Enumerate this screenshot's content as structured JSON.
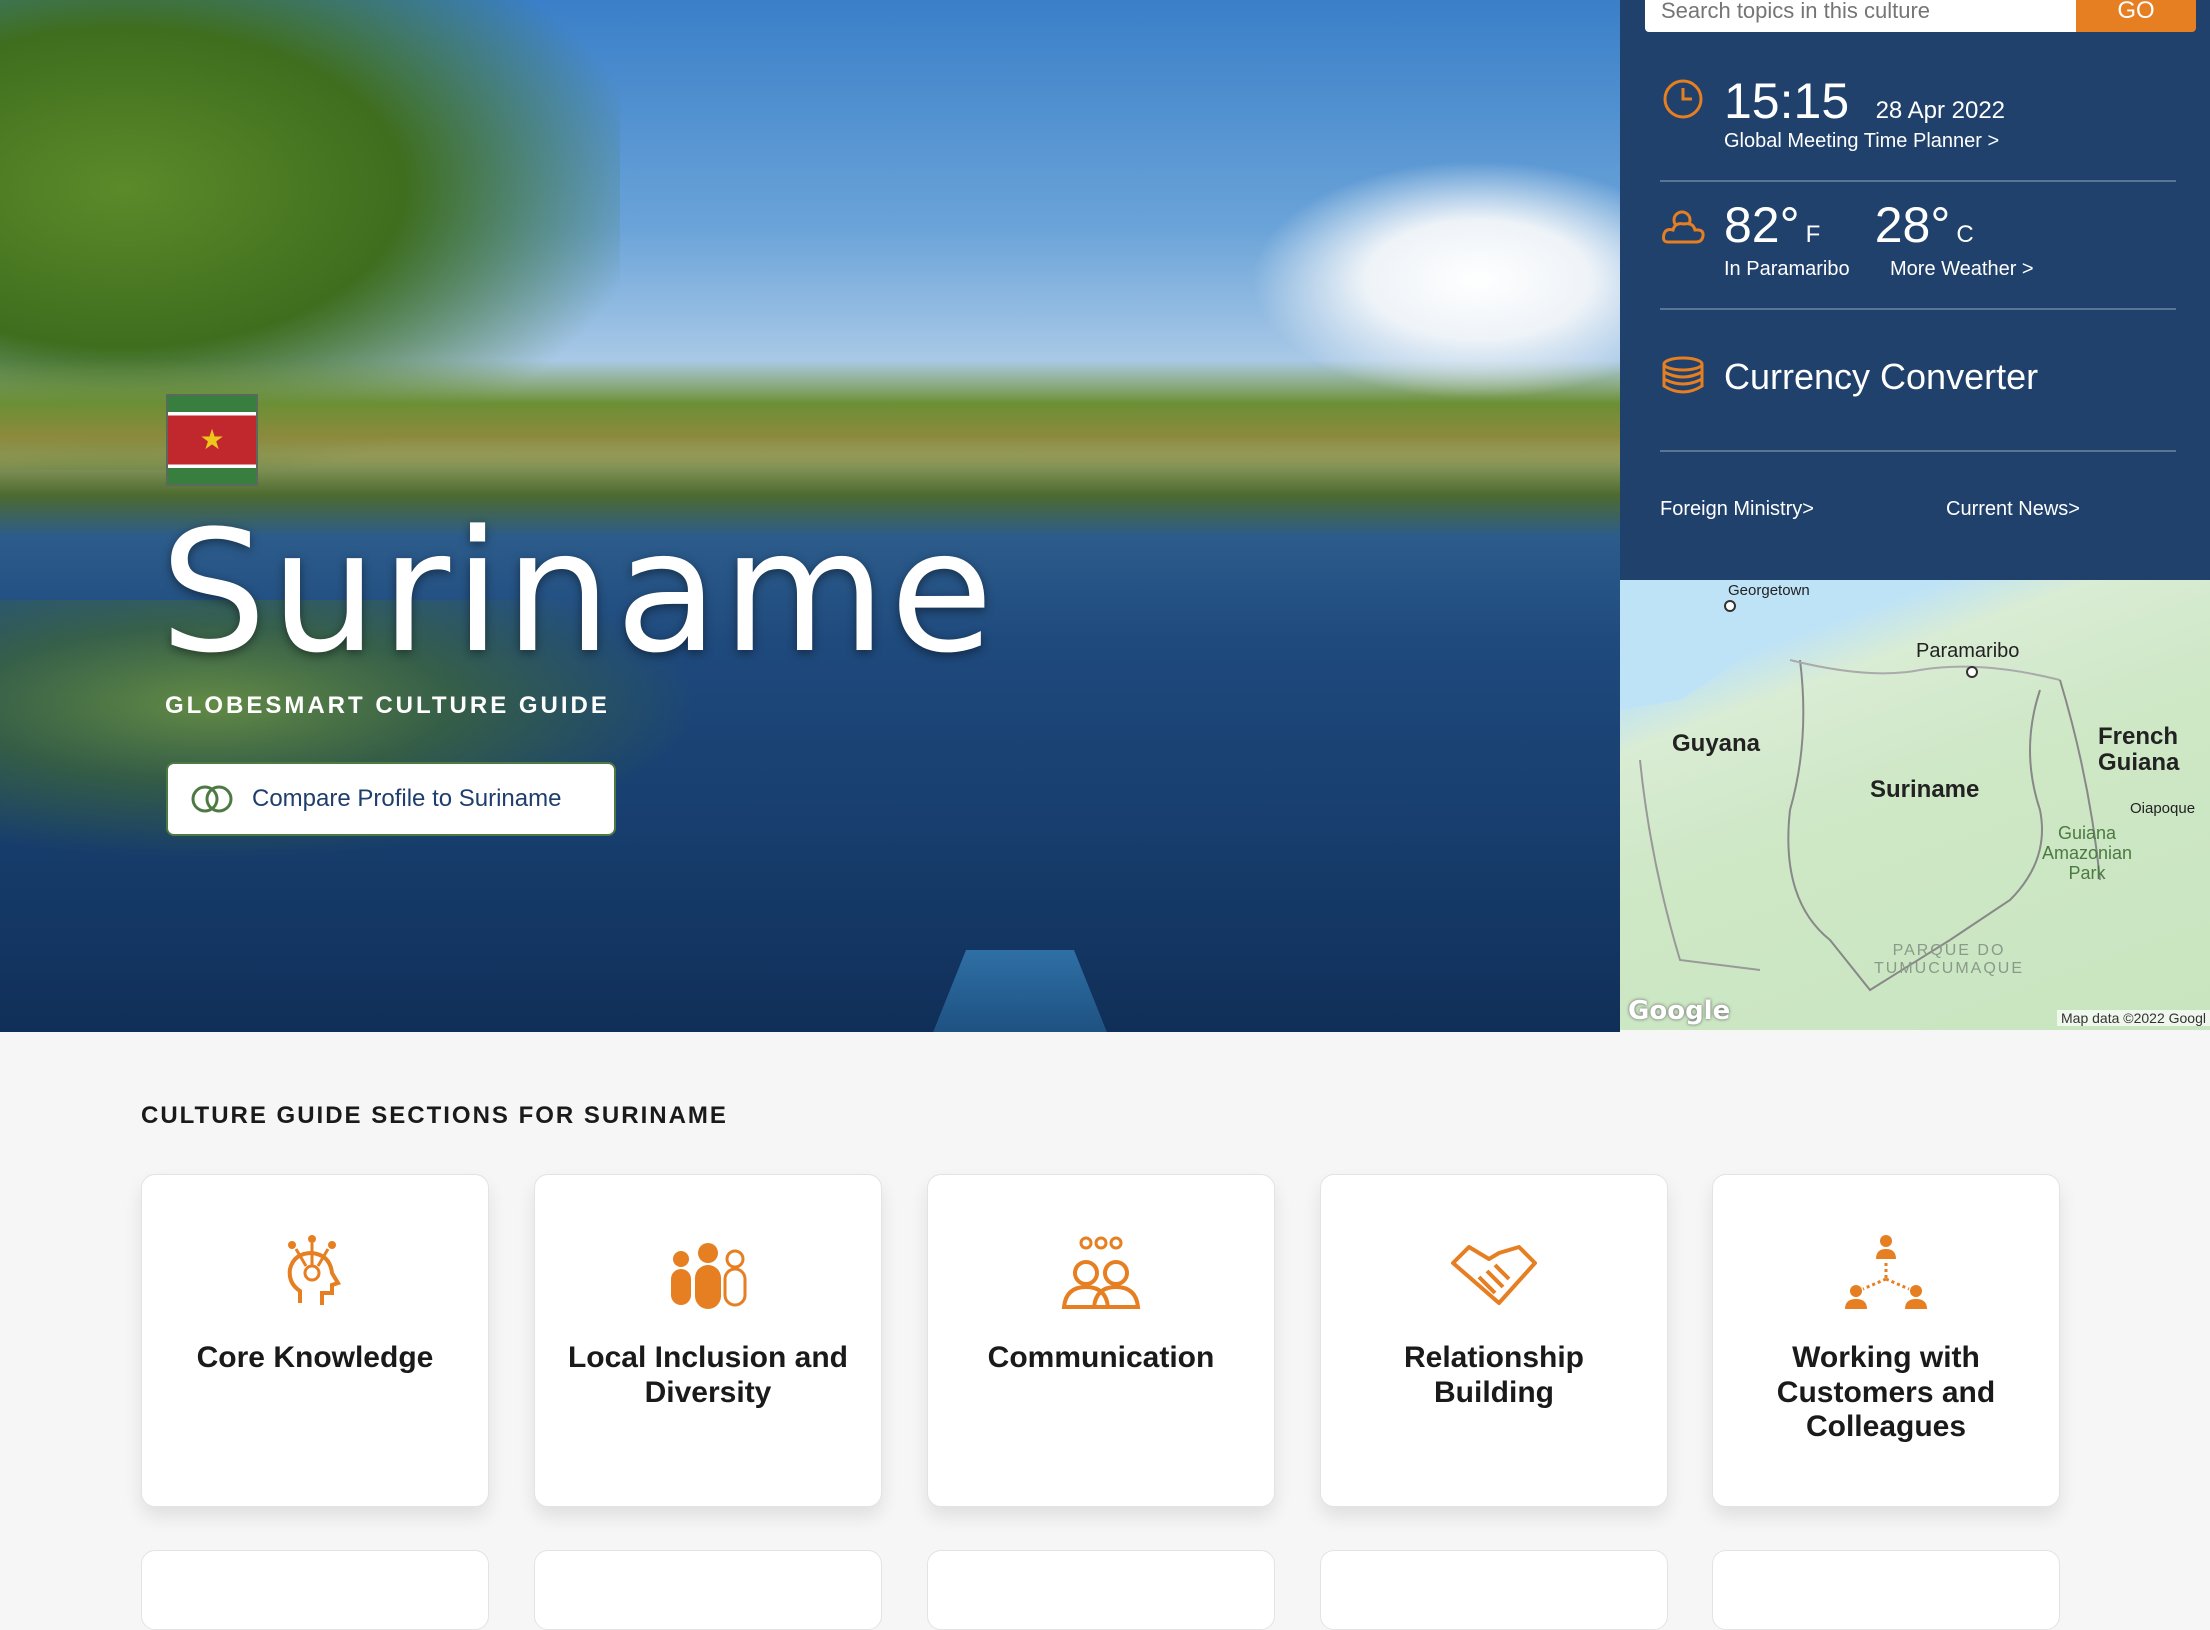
{
  "country": {
    "name": "Suriname",
    "subtitle": "GLOBESMART CULTURE GUIDE",
    "compare_label": "Compare Profile to Suriname",
    "flag_star": "★"
  },
  "search": {
    "placeholder": "Search topics in this culture",
    "go_label": "GO"
  },
  "time": {
    "clock": "15:15",
    "date": "28 Apr 2022",
    "planner_link": "Global Meeting Time Planner >"
  },
  "weather": {
    "temp_f": "82°",
    "unit_f": "F",
    "temp_c": "28°",
    "unit_c": "C",
    "location": "In Paramaribo",
    "more_link": "More Weather >"
  },
  "currency": {
    "label": "Currency Converter"
  },
  "links": {
    "foreign_ministry": "Foreign Ministry>",
    "current_news": "Current News>"
  },
  "map": {
    "georgetown": "Georgetown",
    "paramaribo": "Paramaribo",
    "guyana": "Guyana",
    "suriname": "Suriname",
    "french_guiana": "French\nGuiana",
    "oiapoque": "Oiapoque",
    "park": "Guiana\nAmazonian\nPark",
    "tumucumaque": "PARQUE DO\nTUMUCUMAQUE",
    "google": "Google",
    "data": "Map data ©2022 Googl"
  },
  "sections": {
    "title": "CULTURE GUIDE SECTIONS FOR SURINAME",
    "cards": [
      {
        "label": "Core Knowledge",
        "icon": "head-idea-icon"
      },
      {
        "label": "Local Inclusion and Diversity",
        "icon": "people-group-icon"
      },
      {
        "label": "Communication",
        "icon": "speaking-people-icon"
      },
      {
        "label": "Relationship Building",
        "icon": "handshake-icon"
      },
      {
        "label": "Working with Customers and Colleagues",
        "icon": "network-people-icon"
      }
    ]
  },
  "colors": {
    "accent": "#e67e22",
    "panel": "#1f416b",
    "flag_green": "#377e3f"
  }
}
